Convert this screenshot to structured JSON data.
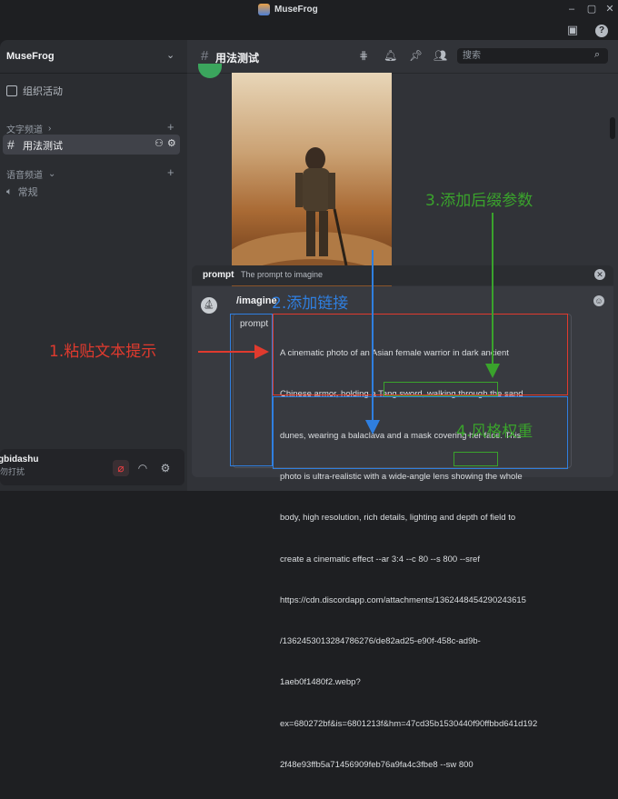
{
  "app": {
    "title": "MuseFrog"
  },
  "server": {
    "name": "MuseFrog",
    "events_label": "组织活动",
    "text_category": "文字频道",
    "active_channel": "用法测试",
    "voice_category": "语音频道",
    "voice_channel": "常规"
  },
  "user": {
    "name": "gbidashu",
    "status": "勿打扰"
  },
  "header": {
    "channel_name": "用法测试",
    "search_placeholder": "搜索"
  },
  "command": {
    "name": "prompt",
    "description": "The prompt to imagine",
    "slash": "/imagine",
    "prompt_label": "prompt",
    "prompt_lines": [
      "A cinematic photo of an Asian female warrior in dark ancient",
      "Chinese armor, holding a Tang sword, walking through the sand",
      "dunes, wearing a balaclava and a mask covering her face. This",
      "photo is ultra-realistic with a wide-angle lens showing the whole",
      "body, high resolution, rich details, lighting and depth of field to",
      "create a cinematic effect --ar 3:4 --c 80 --s 800 --sref",
      "https://cdn.discordapp.com/attachments/1362448454290243615",
      "/1362453013284786276/de82ad25-e90f-458c-ad9b-",
      "1aeb0f1480f2.webp?",
      "ex=680272bf&is=6801213f&hm=47cd35b1530440f90ffbbd641d192",
      "2f48e93ffb5a71456909feb76a9fa4c3fbe8 --sw 800"
    ]
  },
  "annotations": {
    "step1": "1.粘贴文本提示",
    "step2": "2.添加链接",
    "step3": "3.添加后缀参数",
    "step4": "4.风格权重"
  },
  "colors": {
    "red": "#e03a2e",
    "blue": "#2f7fe0",
    "green": "#3aa32c"
  }
}
